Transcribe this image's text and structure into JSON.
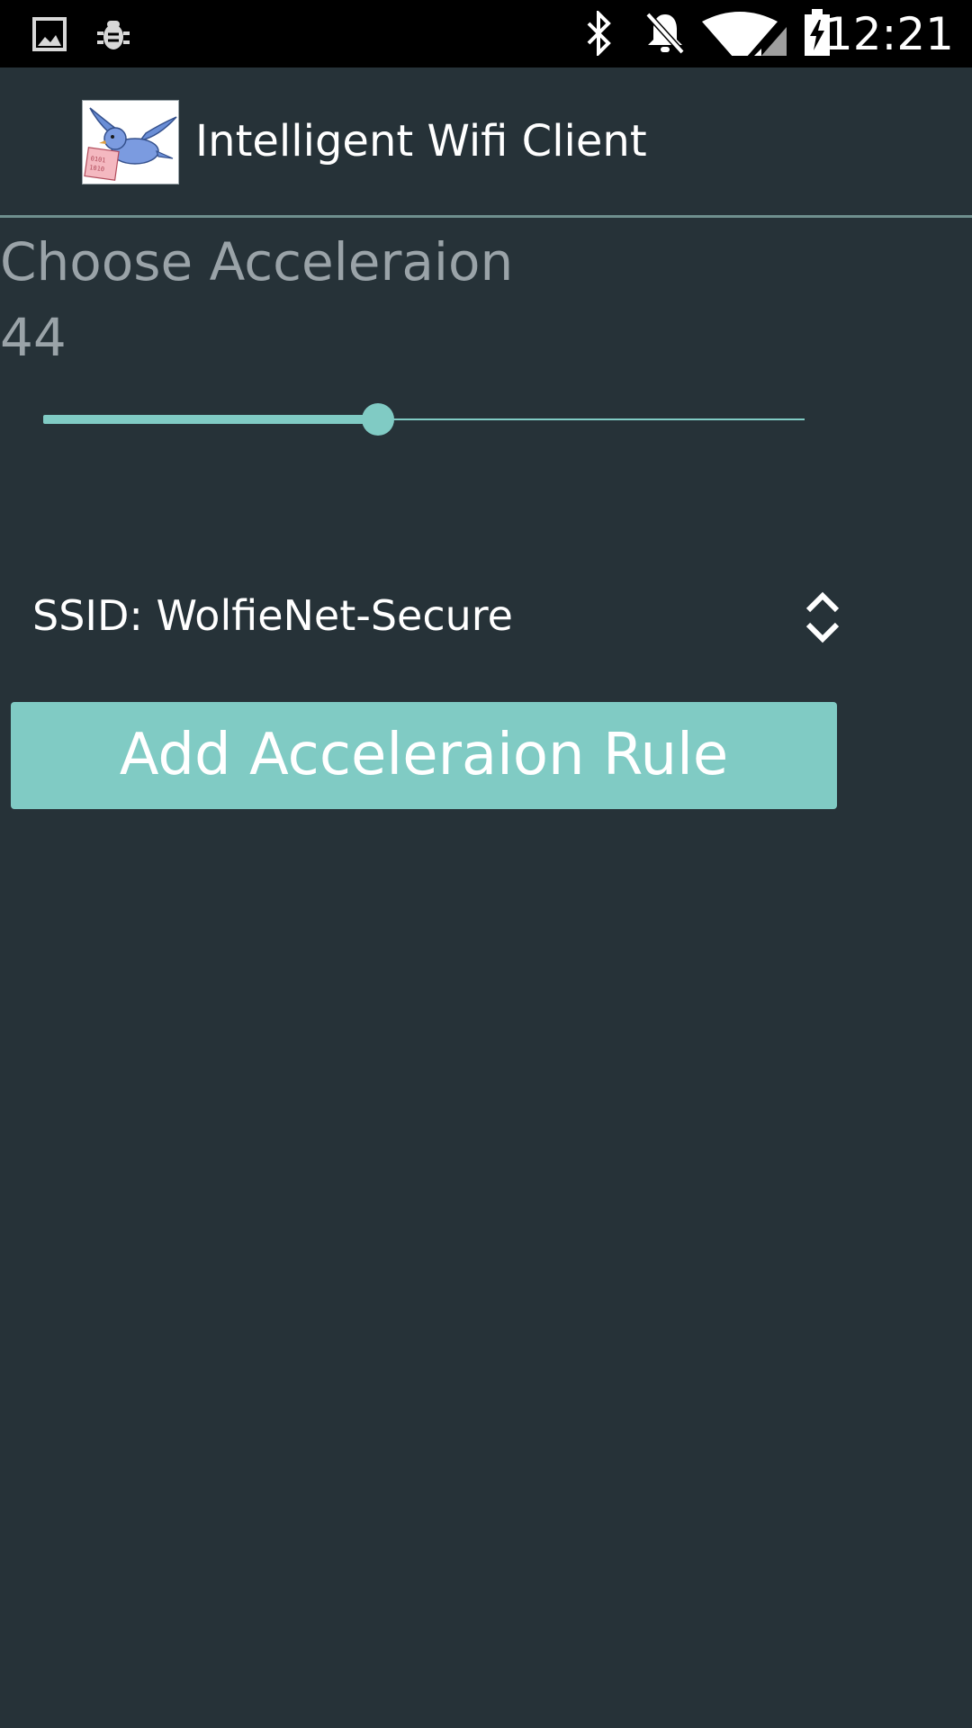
{
  "status_bar": {
    "time": "12:21",
    "icons": [
      "gallery-icon",
      "bug-icon",
      "bluetooth-icon",
      "notifications-off-icon",
      "wifi-icon",
      "battery-charging-icon"
    ]
  },
  "action_bar": {
    "title": "Intelligent Wifi Client",
    "logo": "bird-logo"
  },
  "acceleration": {
    "label": "Choose Acceleraion",
    "value": "44",
    "slider_fraction": 0.44
  },
  "ssid_spinner": {
    "selected": "SSID: WolfieNet-Secure"
  },
  "add_button": {
    "label": "Add Acceleraion Rule"
  },
  "colors": {
    "background": "#263238",
    "accent": "#80cbc4",
    "status_bar": "#000000",
    "secondary_text": "#9aa3a8",
    "primary_text": "#ffffff"
  }
}
